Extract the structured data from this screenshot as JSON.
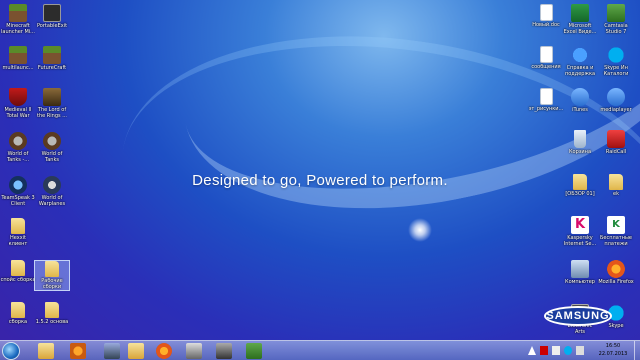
{
  "wallpaper": {
    "slogan": "Designed to go, Powered to perform.",
    "brand": "SAMSUNG"
  },
  "desktop": {
    "left_icons": [
      {
        "label": "Minecraft launcher Mi...",
        "icon": "minecraft-icon"
      },
      {
        "label": "PortableExit",
        "icon": "app-icon"
      },
      {
        "label": "multilaunc...",
        "icon": "minecraft-icon"
      },
      {
        "label": "FutureCraft",
        "icon": "minecraft-icon"
      },
      {
        "label": "Medieval II Total War",
        "icon": "shield-icon"
      },
      {
        "label": "The Lord of the Rings ...",
        "icon": "game-icon"
      },
      {
        "label": "World of Tanks -...",
        "icon": "tank-icon"
      },
      {
        "label": "World of Tanks",
        "icon": "tank-icon"
      },
      {
        "label": "TeamSpeak 3 Client",
        "icon": "teamspeak-icon"
      },
      {
        "label": "World of Warplanes",
        "icon": "warplanes-icon"
      },
      {
        "label": "Hexxit клиент",
        "icon": "folder-icon"
      },
      {
        "label": "спойс сборка",
        "icon": "folder-icon"
      },
      {
        "label": "Рабочие сборки",
        "icon": "folder-icon"
      },
      {
        "label": "сборка",
        "icon": "folder-icon"
      },
      {
        "label": "1.5.2 основа",
        "icon": "folder-icon"
      }
    ],
    "right_icons": [
      {
        "label": "Новый.doc",
        "icon": "document-icon"
      },
      {
        "label": "Microsoft Excel Виде...",
        "icon": "excel-icon"
      },
      {
        "label": "Camtasia Studio 7",
        "icon": "camtasia-icon"
      },
      {
        "label": "сообщения",
        "icon": "document-icon"
      },
      {
        "label": "Справка и поддержка",
        "icon": "help-icon"
      },
      {
        "label": "Skype Ин Каталоги",
        "icon": "skype-icon"
      },
      {
        "label": "эт_рисунки...",
        "icon": "document-icon"
      },
      {
        "label": "iTunes",
        "icon": "media-icon"
      },
      {
        "label": "mediaplayer",
        "icon": "media-icon"
      },
      {
        "label": "Корзина",
        "icon": "recycle-bin-icon"
      },
      {
        "label": "RaidCall",
        "icon": "raidcall-icon"
      },
      {
        "label": "[ОБЗОР 01]",
        "icon": "folder-icon"
      },
      {
        "label": "ek",
        "icon": "folder-icon"
      },
      {
        "label": "Kaspersky Internet Se...",
        "icon": "kaspersky-icon"
      },
      {
        "label": "Бесплатные платежи",
        "icon": "kaspersky-icon"
      },
      {
        "label": "Компьютер",
        "icon": "computer-icon"
      },
      {
        "label": "Mozilla Firefox",
        "icon": "firefox-icon"
      },
      {
        "label": "Electronic Arts",
        "icon": "ea-icon"
      },
      {
        "label": "Skype",
        "icon": "skype-icon"
      }
    ]
  },
  "taskbar": {
    "pinned": [
      "explorer-icon",
      "media-player-icon",
      "firefox-icon",
      "skype-icon",
      "network-icon",
      "camtasia-icon"
    ],
    "clock_time": "16:50",
    "clock_date": "22.07.2013"
  }
}
